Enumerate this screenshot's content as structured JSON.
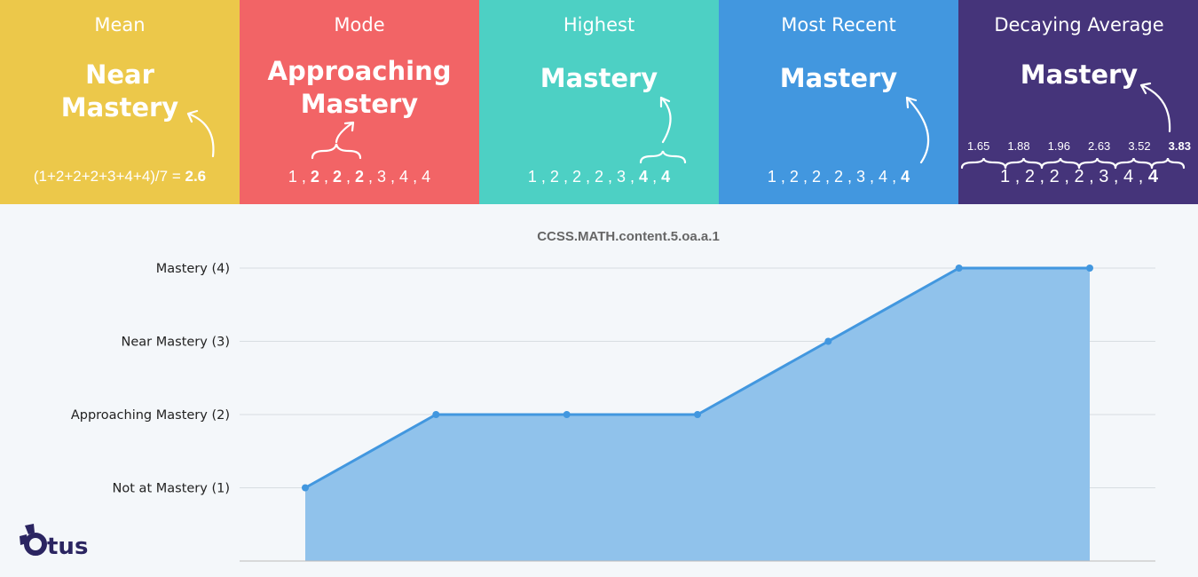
{
  "panels": [
    {
      "title": "Mean",
      "value": "Near Mastery",
      "color": "#ecc84a",
      "formula": "(1+2+2+2+3+4+4)/7 = ",
      "result": "2.6"
    },
    {
      "title": "Mode",
      "value": "Approaching Mastery",
      "color": "#f26466",
      "sequence": [
        {
          "v": "1",
          "b": false
        },
        {
          "v": "2",
          "b": true
        },
        {
          "v": "2",
          "b": true
        },
        {
          "v": "2",
          "b": true
        },
        {
          "v": "3",
          "b": false
        },
        {
          "v": "4",
          "b": false
        },
        {
          "v": "4",
          "b": false
        }
      ]
    },
    {
      "title": "Highest",
      "value": "Mastery",
      "color": "#4dd0c4",
      "sequence": [
        {
          "v": "1",
          "b": false
        },
        {
          "v": "2",
          "b": false
        },
        {
          "v": "2",
          "b": false
        },
        {
          "v": "2",
          "b": false
        },
        {
          "v": "3",
          "b": false
        },
        {
          "v": "4",
          "b": true
        },
        {
          "v": "4",
          "b": true
        }
      ]
    },
    {
      "title": "Most Recent",
      "value": "Mastery",
      "color": "#4297df",
      "sequence": [
        {
          "v": "1",
          "b": false
        },
        {
          "v": "2",
          "b": false
        },
        {
          "v": "2",
          "b": false
        },
        {
          "v": "2",
          "b": false
        },
        {
          "v": "3",
          "b": false
        },
        {
          "v": "4",
          "b": false
        },
        {
          "v": "4",
          "b": true
        }
      ]
    },
    {
      "title": "Decaying Average",
      "value": "Mastery",
      "color": "#45347a",
      "decaying": [
        "1.65",
        "1.88",
        "1.96",
        "2.63",
        "3.52",
        "3.83"
      ],
      "sequence": [
        {
          "v": "1",
          "b": false
        },
        {
          "v": "2",
          "b": false
        },
        {
          "v": "2",
          "b": false
        },
        {
          "v": "2",
          "b": false
        },
        {
          "v": "3",
          "b": false
        },
        {
          "v": "4",
          "b": false
        },
        {
          "v": "4",
          "b": true
        }
      ]
    }
  ],
  "logo": "Otus",
  "chart_data": {
    "type": "area",
    "title": "CCSS.MATH.content.5.oa.a.1",
    "yticks": [
      {
        "value": 4,
        "label": "Mastery (4)"
      },
      {
        "value": 3,
        "label": "Near Mastery (3)"
      },
      {
        "value": 2,
        "label": "Approaching Mastery (2)"
      },
      {
        "value": 1,
        "label": "Not at Mastery (1)"
      }
    ],
    "values": [
      1,
      2,
      2,
      2,
      3,
      4,
      4
    ],
    "ylim": [
      0,
      4
    ],
    "grid": true,
    "line_color": "#4297df",
    "fill_color": "#90c2eb"
  }
}
